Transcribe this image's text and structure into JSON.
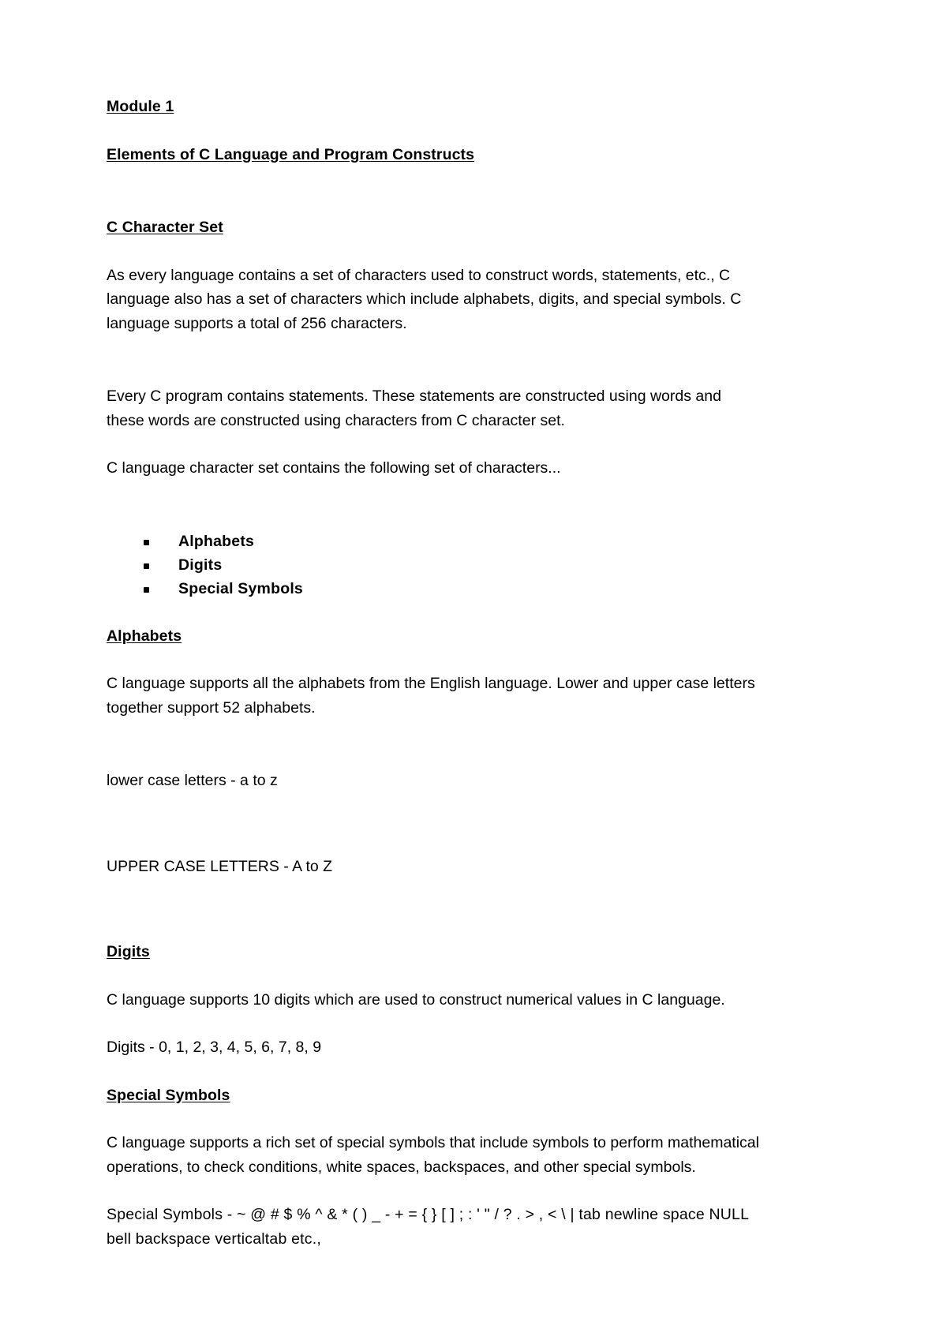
{
  "document": {
    "title": "Module 1",
    "subtitle": "Elements of C Language and Program Constructs",
    "sections": {
      "char_set": {
        "heading": "C Character Set",
        "para1": "As every language contains a set of characters used to construct words, statements, etc., C language also has a set of characters which include alphabets, digits, and special symbols. C language supports a total of 256 characters.",
        "para2": "Every C program contains statements. These statements are constructed using words and these words are constructed using characters from C character set.",
        "para3": " C language character set contains the following set of characters...",
        "bullets": [
          "Alphabets",
          "Digits",
          "Special Symbols"
        ]
      },
      "alphabets": {
        "heading": "Alphabets",
        "para1": "C language supports all the alphabets from the English language. Lower and upper case letters together support 52 alphabets.",
        "lower_case": "lower case letters - a to z",
        "upper_case": "UPPER CASE LETTERS - A to Z"
      },
      "digits": {
        "heading": "Digits",
        "para1": "C language supports 10 digits which are used to construct numerical values in C language.",
        "list": "Digits - 0, 1, 2, 3, 4, 5, 6, 7, 8, 9"
      },
      "special_symbols": {
        "heading": "Special Symbols",
        "para1": "C language supports a rich set of special symbols that include symbols to perform mathematical operations, to check conditions, white spaces, backspaces, and other special symbols.",
        "list": "Special Symbols - ~ @ # $ % ^ & * ( ) _ - + = { } [ ] ; : ' \" / ? . > , < \\ | tab newline space NULL bell backspace verticaltab etc.,"
      }
    }
  }
}
